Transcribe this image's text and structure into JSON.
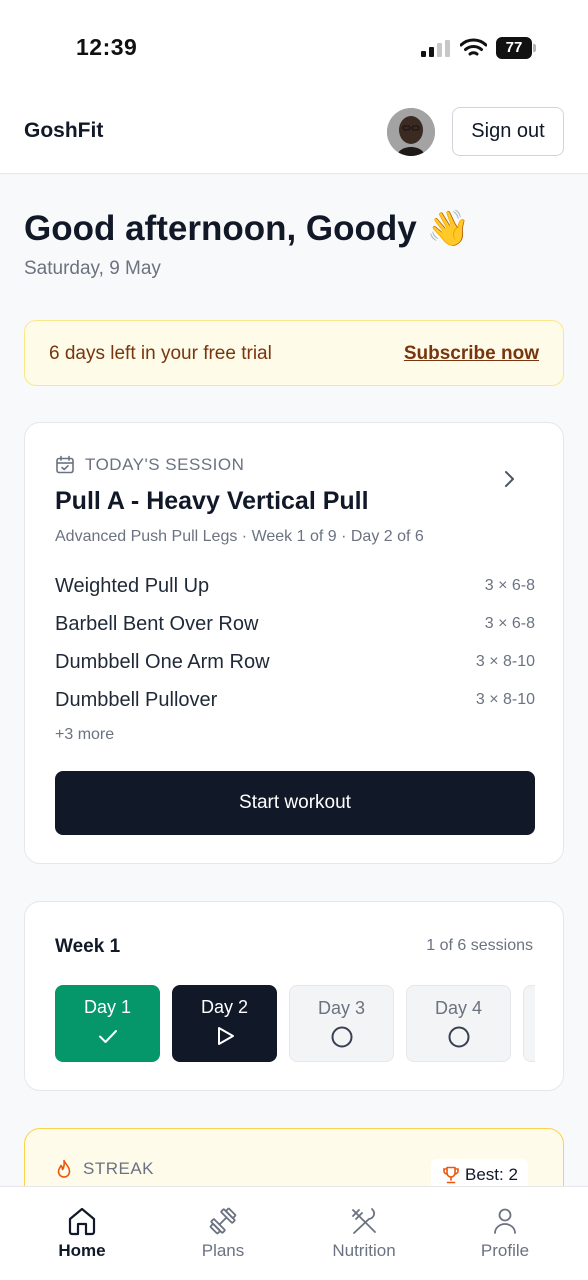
{
  "status_bar": {
    "time": "12:39",
    "battery": "77"
  },
  "header": {
    "brand": "GoshFit",
    "sign_out": "Sign out"
  },
  "greeting": {
    "title": "Good afternoon, Goody 👋",
    "date": "Saturday, 9 May"
  },
  "trial": {
    "text": "6 days left in your free trial",
    "link": "Subscribe now"
  },
  "session": {
    "label": "TODAY'S SESSION",
    "title": "Pull A - Heavy Vertical Pull",
    "meta": "Advanced Push Pull Legs · Week 1 of 9 · Day 2 of 6",
    "exercises": [
      {
        "name": "Weighted Pull Up",
        "sets": "3 × 6-8"
      },
      {
        "name": "Barbell Bent Over Row",
        "sets": "3 × 6-8"
      },
      {
        "name": "Dumbbell One Arm Row",
        "sets": "3 × 8-10"
      },
      {
        "name": "Dumbbell Pullover",
        "sets": "3 × 8-10"
      }
    ],
    "more": "+3 more",
    "start": "Start workout"
  },
  "week": {
    "title": "Week 1",
    "count": "1 of 6 sessions",
    "days": [
      {
        "label": "Day 1",
        "state": "done"
      },
      {
        "label": "Day 2",
        "state": "current"
      },
      {
        "label": "Day 3",
        "state": "todo"
      },
      {
        "label": "Day 4",
        "state": "todo"
      }
    ]
  },
  "streak": {
    "label": "STREAK",
    "best": "Best: 2"
  },
  "nav": [
    {
      "label": "Home",
      "icon": "home-icon",
      "active": true
    },
    {
      "label": "Plans",
      "icon": "dumbbell-icon",
      "active": false
    },
    {
      "label": "Nutrition",
      "icon": "utensils-icon",
      "active": false
    },
    {
      "label": "Profile",
      "icon": "user-icon",
      "active": false
    }
  ],
  "colors": {
    "primary_dark": "#111827",
    "success": "#059669",
    "trial_bg": "#fefce8",
    "trial_text": "#78350f",
    "streak_accent": "#ea580c"
  }
}
